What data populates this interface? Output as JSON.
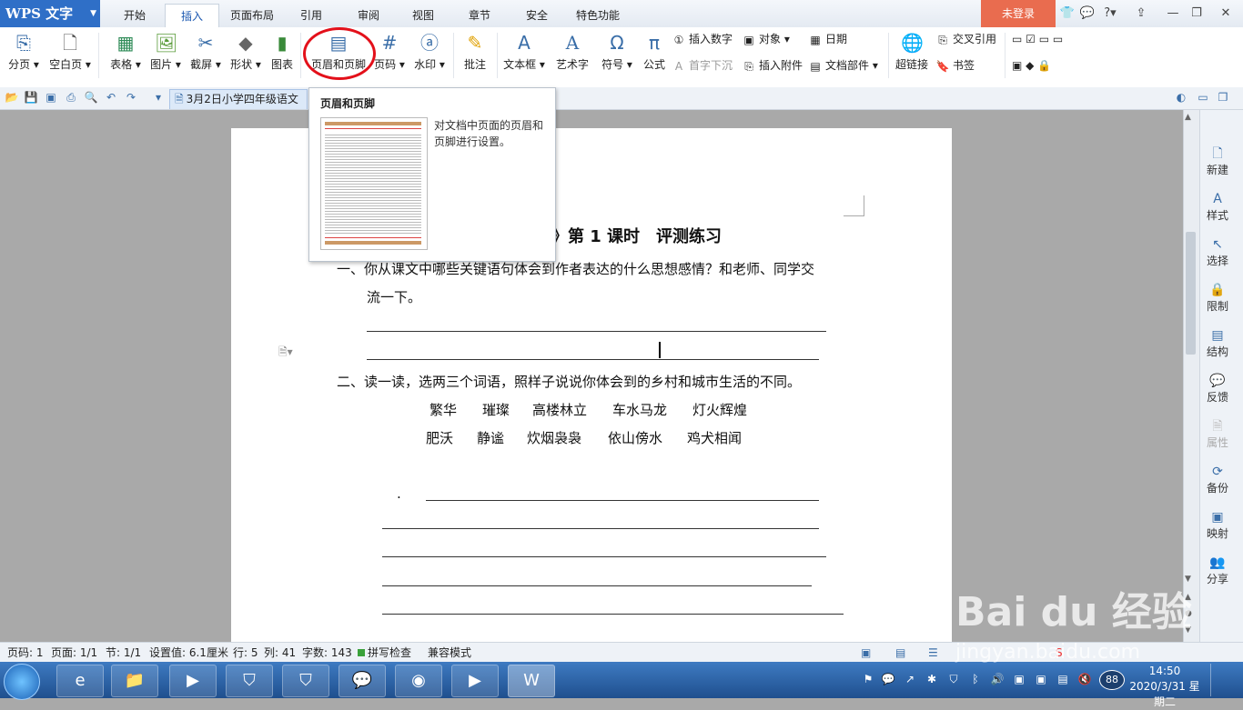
{
  "app": {
    "logo": "WPS 文字"
  },
  "menu": {
    "tabs": [
      "开始",
      "插入",
      "页面布局",
      "引用",
      "审阅",
      "视图",
      "章节",
      "安全",
      "特色功能"
    ],
    "active_tab": "插入",
    "login": "未登录"
  },
  "ribbon": {
    "page_break": "分页",
    "blank_page": "空白页",
    "table": "表格",
    "picture": "图片",
    "screenshot": "截屏",
    "shape": "形状",
    "chart": "图表",
    "header_footer": "页眉和页脚",
    "page_number": "页码",
    "watermark": "水印",
    "comment": "批注",
    "textbox": "文本框",
    "wordart": "艺术字",
    "symbol": "符号",
    "formula": "公式",
    "insert_number": "插入数字",
    "drop_cap": "首字下沉",
    "object": "对象",
    "insert_attachment": "插入附件",
    "date": "日期",
    "doc_parts": "文档部件",
    "hyperlink": "超链接",
    "cross_ref": "交叉引用",
    "bookmark": "书签"
  },
  "doc_tab": {
    "title": "3月2日小学四年级语文"
  },
  "tooltip": {
    "title": "页眉和页脚",
    "description": "对文档中页面的页眉和页脚进行设置。"
  },
  "document": {
    "heading": "》第 1 课时　评测练习",
    "q1_line1": "一、你从课文中哪些关键语句体会到作者表达的什么思想感情？和老师、同学交",
    "q1_line2": "流一下。",
    "q2": "二、读一读，选两三个词语，照样子说说你体会到的乡村和城市生活的不同。",
    "words_row1": [
      "繁华",
      "璀璨",
      "高楼林立",
      "车水马龙",
      "灯火辉煌"
    ],
    "words_row2": [
      "肥沃",
      "静谧",
      "炊烟袅袅",
      "依山傍水",
      "鸡犬相闻"
    ],
    "dot": "."
  },
  "sidebar": {
    "items": [
      "新建",
      "样式",
      "选择",
      "限制",
      "结构",
      "反馈",
      "属性",
      "备份",
      "映射",
      "分享"
    ]
  },
  "status": {
    "page_code": "页码: 1",
    "pages": "页面: 1/1",
    "section": "节: 1/1",
    "setting": "设置值: 6.1厘米",
    "row": "行: 5",
    "col": "列: 41",
    "words": "字数: 143",
    "spellcheck": "拼写检查",
    "compat": "兼容模式"
  },
  "taskbar": {
    "time": "14:50",
    "date": "2020/3/31 星期二",
    "badge": "88"
  },
  "watermark": {
    "text": "Bai du 经验",
    "url": "jingyan.baidu.com"
  }
}
